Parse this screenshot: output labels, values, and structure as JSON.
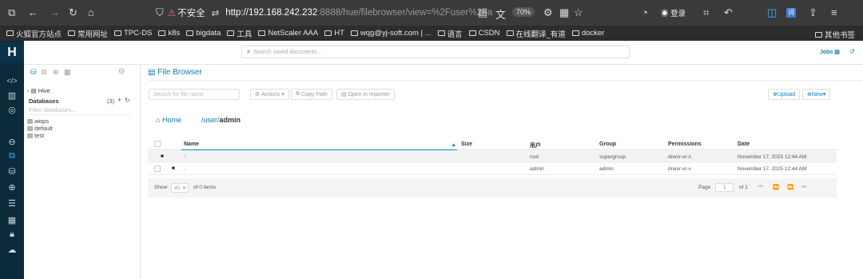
{
  "browser": {
    "url_host": "http://192.168.242.232",
    "url_rest": ":8888/hue/filebrowser/view=%2Fuser%2Fa",
    "security_label": "不安全",
    "zoom": "70%",
    "login_label": "登录",
    "bookmarks": [
      "火狐官方站点",
      "常用网址",
      "TPC-DS",
      "k8s",
      "bigdata",
      "工具",
      "NetScaler AAA",
      "HT",
      "wqg@yj-soft.com | ...",
      "语言",
      "CSDN",
      "在线翻译_有道",
      "docker"
    ],
    "other_bookmarks": "其他书签"
  },
  "hue": {
    "search_placeholder": "Search saved documents...",
    "jobs_label": "Jobs"
  },
  "assist": {
    "back_label": "Hive",
    "databases_label": "Databases",
    "db_count": "(3)",
    "filter_placeholder": "Filter databases...",
    "databases": [
      "aiops",
      "default",
      "test"
    ]
  },
  "filebrowser": {
    "title": "File Browser",
    "search_placeholder": "Search for file name",
    "actions_label": "Actions",
    "copy_path_label": "Copy Path",
    "open_importer_label": "Open in importer",
    "upload_label": "Upload",
    "new_label": "New",
    "home_label": "Home",
    "path_prefix": "/user/",
    "path_leaf": "admin",
    "columns": [
      "Name",
      "Size",
      "用户",
      "Group",
      "Permissions",
      "Date"
    ],
    "rows": [
      {
        "name": "↑",
        "size": "",
        "user": "root",
        "group": "supergroup",
        "permissions": "drwxr-xr-x",
        "date": "November 17, 2025 12:44 AM"
      },
      {
        "name": ".",
        "size": "",
        "user": "admin",
        "group": "admin",
        "permissions": "drwxr-xr-x",
        "date": "November 17, 2025 12:44 AM"
      }
    ],
    "show_label": "Show",
    "page_size": "45",
    "of_items": "of 0 items",
    "page_label": "Page",
    "page_number": "1",
    "of_pages": "of 1"
  }
}
